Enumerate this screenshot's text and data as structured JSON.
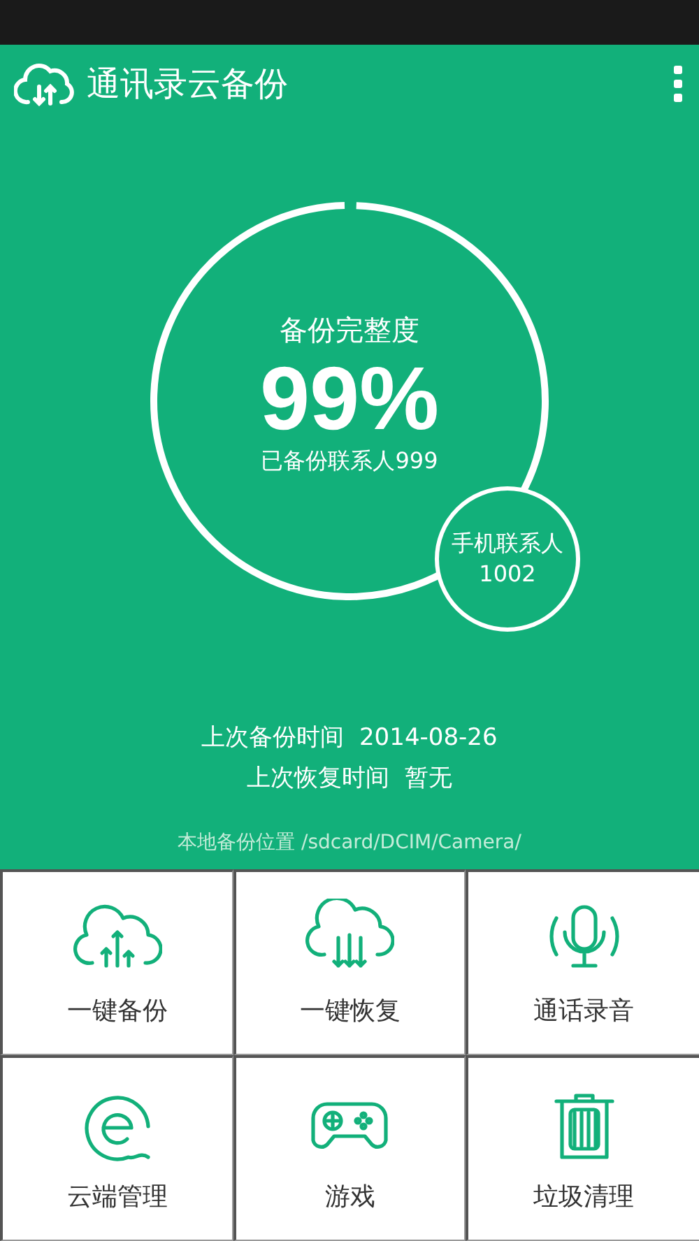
{
  "app_bar": {
    "title": "通讯录云备份"
  },
  "summary": {
    "heading": "备份完整度",
    "percent": "99%",
    "level": 0.99,
    "backed_up": "已备份联系人999",
    "phone_contacts_label": "手机联系人",
    "phone_contacts_count": "1002"
  },
  "times": [
    {
      "label": "上次备份时间",
      "value": "2014-08-26"
    },
    {
      "label": "上次恢复时间",
      "value": "暂无"
    }
  ],
  "backup_location": "本地备份位置 /sdcard/DCIM/Camera/",
  "actions": [
    {
      "kind": "backup",
      "label": "一键备份"
    },
    {
      "kind": "restore",
      "label": "一键恢复"
    },
    {
      "kind": "record",
      "label": "通话录音"
    },
    {
      "kind": "cloud",
      "label": "云端管理"
    },
    {
      "kind": "game",
      "label": "游戏"
    },
    {
      "kind": "clean",
      "label": "垃圾清理"
    }
  ]
}
